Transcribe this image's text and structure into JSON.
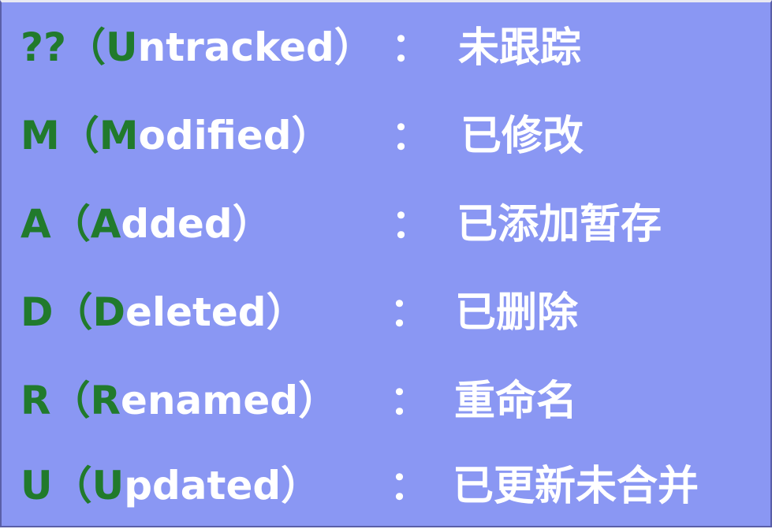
{
  "rows": [
    {
      "code": "??",
      "open": "（",
      "first": "U",
      "rest": "ntracked",
      "close": "）",
      "colon": "：",
      "desc": "未跟踪"
    },
    {
      "code": "M",
      "open": "（",
      "first": "M",
      "rest": "odified",
      "close": "）",
      "colon": "：",
      "desc": "已修改"
    },
    {
      "code": "A",
      "open": "（",
      "first": "A",
      "rest": "dded",
      "close": "）",
      "colon": "：",
      "desc": "已添加暂存"
    },
    {
      "code": "D",
      "open": "（",
      "first": "D",
      "rest": "eleted",
      "close": "）",
      "colon": "：",
      "desc": "已删除"
    },
    {
      "code": "R",
      "open": "（",
      "first": "R",
      "rest": "enamed",
      "close": "）",
      "colon": "：",
      "desc": "重命名"
    },
    {
      "code": "U",
      "open": "（",
      "first": "U",
      "rest": "pdated",
      "close": "）",
      "colon": "：",
      "desc": "已更新未合并"
    }
  ],
  "colors": {
    "background": "#8a97f3",
    "code_green": "#217a2c",
    "text": "#ffffff"
  }
}
